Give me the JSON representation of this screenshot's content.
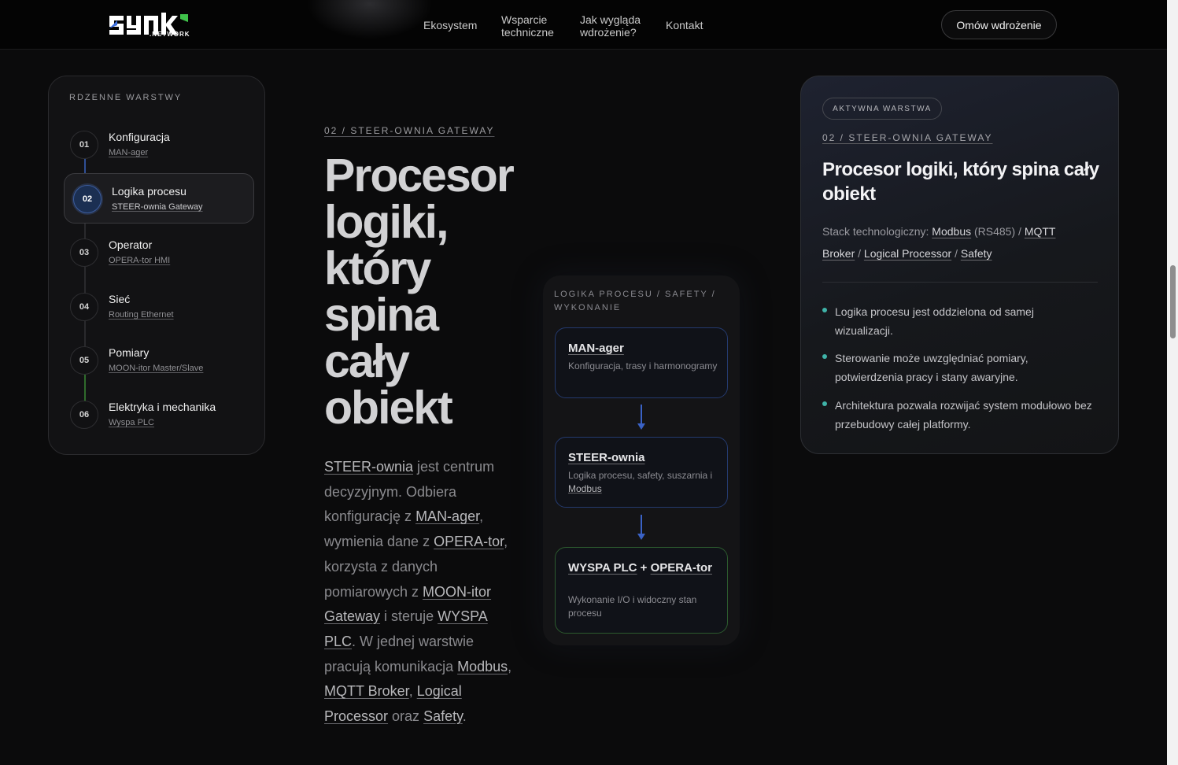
{
  "header": {
    "logo_net": ".NETWORK",
    "nav": [
      {
        "label": "Ekosystem"
      },
      {
        "label_line1": "Wsparcie",
        "label_line2": "techniczne"
      },
      {
        "label_line1": "Jak wygląda",
        "label_line2": "wdrożenie?"
      },
      {
        "label": "Kontakt"
      }
    ],
    "cta": "Omów wdrożenie"
  },
  "layers": {
    "title": "RDZENNE WARSTWY",
    "active_index": 1,
    "items": [
      {
        "num": "01",
        "title": "Konfiguracja",
        "sub": "MAN-ager"
      },
      {
        "num": "02",
        "title": "Logika procesu",
        "sub": "STEER-ownia Gateway"
      },
      {
        "num": "03",
        "title": "Operator",
        "sub": "OPERA-tor HMI"
      },
      {
        "num": "04",
        "title": "Sieć",
        "sub": "Routing Ethernet"
      },
      {
        "num": "05",
        "title": "Pomiary",
        "sub": "MOON-itor Master/Slave"
      },
      {
        "num": "06",
        "title": "Elektryka i mechanika",
        "sub": "Wyspa PLC"
      }
    ]
  },
  "main": {
    "kicker": "02 / STEER-OWNIA GATEWAY",
    "title_lines": [
      "Procesor",
      "logiki,",
      "który",
      "spina",
      "cały",
      "obiekt"
    ],
    "desc": {
      "p1": "STEER-ownia",
      "t1": " jest centrum decyzyjnym. Odbiera konfigurację z ",
      "p2": "MAN-ager",
      "t2": ", wymienia dane z ",
      "p3": "OPERA-tor",
      "t3": ", korzysta z danych pomiarowych z ",
      "p4": "MOON-itor Gateway",
      "t4": " i steruje ",
      "p5": "WYSPA PLC",
      "t5": ". W jednej warstwie pracują komunikacja ",
      "p6": "Modbus",
      "t6": ", ",
      "p7": "MQTT Broker",
      "t7": ", ",
      "p8": "Logical Processor",
      "t8": " oraz ",
      "p9": "Safety",
      "t9": "."
    }
  },
  "flow": {
    "title": "LOGIKA PROCESU / SAFETY / WYKONANIE",
    "nodes": [
      {
        "title": "MAN-ager",
        "desc": "Konfiguracja, trasy i harmonogramy"
      },
      {
        "title": "STEER-ownia",
        "desc_pre": "Logika procesu, safety, suszarnia i ",
        "desc_link": "Modbus"
      },
      {
        "title_a": "WYSPA PLC",
        "title_mid": " + ",
        "title_b": "OPERA-tor",
        "desc": "Wykonanie I/O i widoczny stan procesu"
      }
    ],
    "colors": {
      "node_border_blue": "#243a6e",
      "node_border_green": "#2c5a2e",
      "arrow": "#3a62c6"
    }
  },
  "detail": {
    "badge": "AKTYWNA WARSTWA",
    "kicker": "02 / STEER-OWNIA GATEWAY",
    "title": "Procesor logiki, który spina cały obiekt",
    "stack_label": "Stack technologiczny: ",
    "stack": {
      "modbus": "Modbus",
      "rs485": " (RS485) / ",
      "mqtt": "MQTT Broker",
      "sep1": " / ",
      "logical": "Logical Processor",
      "sep2": " / ",
      "safety": "Safety"
    },
    "bullets": [
      "Logika procesu jest oddzielona od samej wizualizacji.",
      "Sterowanie może uwzględniać pomiary, potwierdzenia pracy i stany awaryjne.",
      "Architektura pozwala rozwijać system modułowo bez przebudowy całej platformy."
    ],
    "bullet_color": "#3fb3a8"
  }
}
